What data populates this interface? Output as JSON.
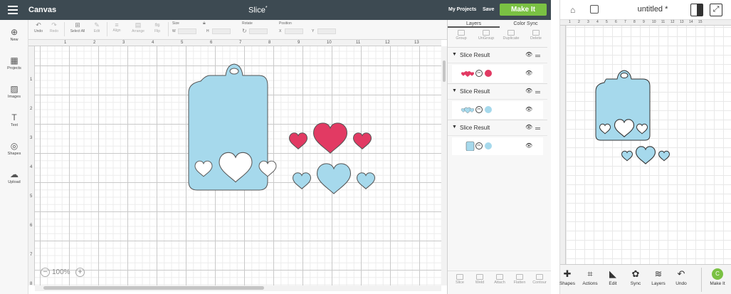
{
  "app": {
    "brand": "Canvas",
    "project_title": "Slice",
    "modified_marker": "*",
    "my_projects": "My Projects",
    "save": "Save",
    "make_it": "Make It"
  },
  "toolbar": {
    "undo": "Undo",
    "redo": "Redo",
    "select_all": "Select All",
    "edit": "Edit",
    "align": "Align",
    "arrange": "Arrange",
    "flip": "Flip",
    "size": "Size",
    "rotate": "Rotate",
    "position": "Position",
    "w": "W",
    "h": "H",
    "x": "X",
    "y": "Y"
  },
  "left_nav": [
    {
      "label": "New",
      "icon": "plus-circle-icon",
      "glyph": "⊕"
    },
    {
      "label": "Projects",
      "icon": "projects-icon",
      "glyph": "▦"
    },
    {
      "label": "Images",
      "icon": "images-icon",
      "glyph": "▨"
    },
    {
      "label": "Text",
      "icon": "text-icon",
      "glyph": "T"
    },
    {
      "label": "Shapes",
      "icon": "shapes-icon",
      "glyph": "◎"
    },
    {
      "label": "Upload",
      "icon": "upload-icon",
      "glyph": "☁"
    }
  ],
  "ruler": {
    "top": [
      "1",
      "2",
      "3",
      "4",
      "5",
      "6",
      "7",
      "8",
      "9",
      "10",
      "11",
      "12",
      "13"
    ],
    "left": [
      "1",
      "2",
      "3",
      "4",
      "5",
      "6",
      "7",
      "8"
    ]
  },
  "zoom": "100%",
  "panel": {
    "tab_layers": "Layers",
    "tab_color_sync": "Color Sync",
    "tools": [
      "Group",
      "UnGroup",
      "Duplicate",
      "Delete"
    ],
    "groups": [
      {
        "name": "Slice Result",
        "color": "#e23a63"
      },
      {
        "name": "Slice Result",
        "color": "#a6d9ec"
      },
      {
        "name": "Slice Result",
        "color": "#a6d9ec"
      }
    ],
    "bottom_tools": [
      "Slice",
      "Weld",
      "Attach",
      "Flatten",
      "Contour"
    ]
  },
  "colors": {
    "tag_blue": "#a6d9ec",
    "heart_pink": "#e23a63",
    "accent_green": "#7ac143",
    "topbar": "#3d4a52"
  },
  "mobile": {
    "title": "untitled",
    "modified_marker": "*",
    "ruler_top": [
      "1",
      "2",
      "3",
      "4",
      "5",
      "6",
      "7",
      "8",
      "9",
      "10",
      "11",
      "12",
      "13",
      "14",
      "15"
    ],
    "bottom": [
      {
        "label": "Shapes",
        "icon": "shapes-icon",
        "glyph": "✚"
      },
      {
        "label": "Actions",
        "icon": "actions-icon",
        "glyph": "⌗"
      },
      {
        "label": "Edit",
        "icon": "edit-icon",
        "glyph": "◣"
      },
      {
        "label": "Sync",
        "icon": "sync-icon",
        "glyph": "✿"
      },
      {
        "label": "Layers",
        "icon": "layers-icon",
        "glyph": "≋"
      },
      {
        "label": "Undo",
        "icon": "undo-icon",
        "glyph": "↶"
      }
    ],
    "make_it": "Make It",
    "make_it_glyph": "C"
  }
}
